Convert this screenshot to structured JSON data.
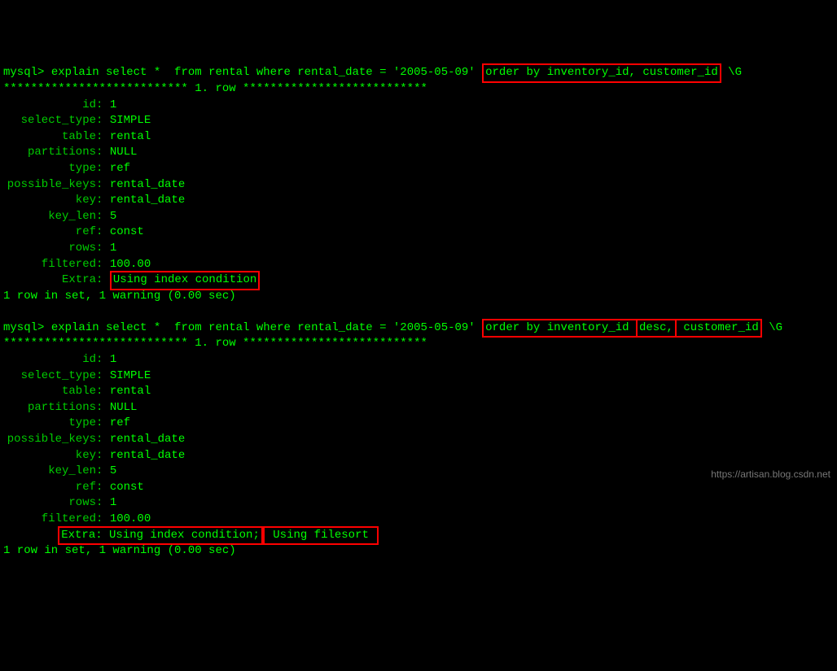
{
  "query1": {
    "prompt": "mysql>",
    "cmd_before": " explain select *  from rental where rental_date = '2005-05-09' ",
    "highlight": "order by inventory_id, customer_id",
    "cmd_after": " \\G",
    "separator": "*************************** 1. row ***************************",
    "fields": [
      {
        "label": "id",
        "value": "1"
      },
      {
        "label": "select_type",
        "value": "SIMPLE"
      },
      {
        "label": "table",
        "value": "rental"
      },
      {
        "label": "partitions",
        "value": "NULL"
      },
      {
        "label": "type",
        "value": "ref"
      },
      {
        "label": "possible_keys",
        "value": "rental_date"
      },
      {
        "label": "key",
        "value": "rental_date"
      },
      {
        "label": "key_len",
        "value": "5"
      },
      {
        "label": "ref",
        "value": "const"
      },
      {
        "label": "rows",
        "value": "1"
      },
      {
        "label": "filtered",
        "value": "100.00"
      }
    ],
    "extra_label": "Extra",
    "extra_value": "Using index condition",
    "status": "1 row in set, 1 warning (0.00 sec)"
  },
  "query2": {
    "prompt": "mysql>",
    "cmd_before": " explain select *  from rental where rental_date = '2005-05-09' ",
    "highlight_main": "order by inventory_id ",
    "highlight_inner": "desc,",
    "highlight_after": " customer_id",
    "cmd_after": " \\G",
    "separator": "*************************** 1. row ***************************",
    "fields": [
      {
        "label": "id",
        "value": "1"
      },
      {
        "label": "select_type",
        "value": "SIMPLE"
      },
      {
        "label": "table",
        "value": "rental"
      },
      {
        "label": "partitions",
        "value": "NULL"
      },
      {
        "label": "type",
        "value": "ref"
      },
      {
        "label": "possible_keys",
        "value": "rental_date"
      },
      {
        "label": "key",
        "value": "rental_date"
      },
      {
        "label": "key_len",
        "value": "5"
      },
      {
        "label": "ref",
        "value": "const"
      },
      {
        "label": "rows",
        "value": "1"
      },
      {
        "label": "filtered",
        "value": "100.00"
      }
    ],
    "extra_label": "Extra",
    "extra_part1": "Extra: Using index condition;",
    "extra_part2": " Using filesort ",
    "status": "1 row in set, 1 warning (0.00 sec)"
  },
  "watermark": "https://artisan.blog.csdn.net"
}
